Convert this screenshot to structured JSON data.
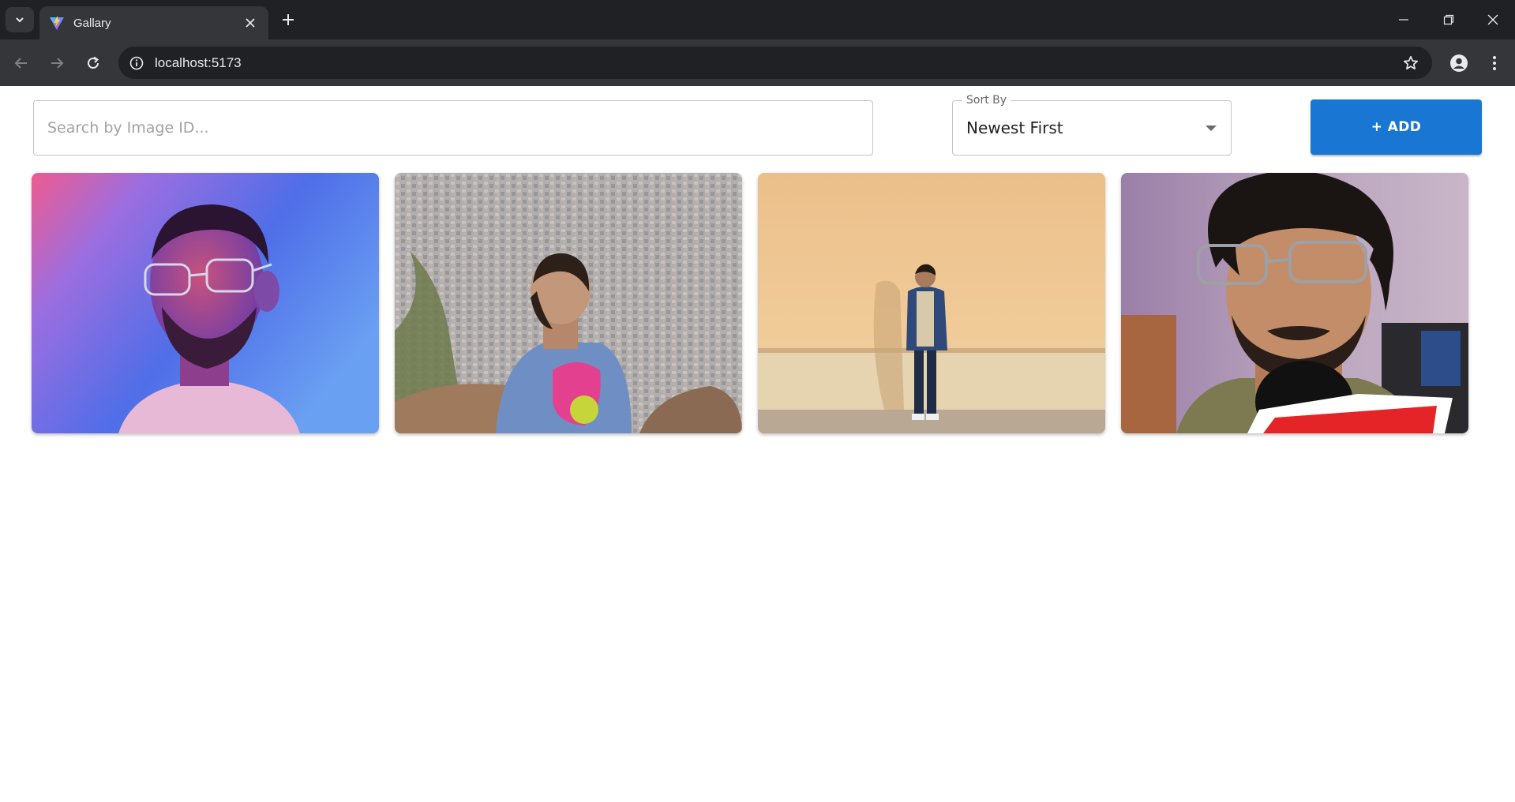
{
  "browser": {
    "tab_title": "Gallary",
    "url": "localhost:5173"
  },
  "toolbar": {
    "search_placeholder": "Search by Image ID...",
    "sort_label": "Sort By",
    "sort_value": "Newest First",
    "add_label": "+ ADD"
  },
  "gallery": {
    "images": [
      {
        "alt": "portrait of man with glasses under pink and blue light"
      },
      {
        "alt": "man in blue printed t-shirt overlooking city"
      },
      {
        "alt": "man standing against a beige wall"
      },
      {
        "alt": "man with curly hair and glasses speaking into microphone"
      }
    ]
  },
  "colors": {
    "chrome_dark": "#202124",
    "chrome_toolbar": "#35363a",
    "accent": "#1976d2"
  }
}
